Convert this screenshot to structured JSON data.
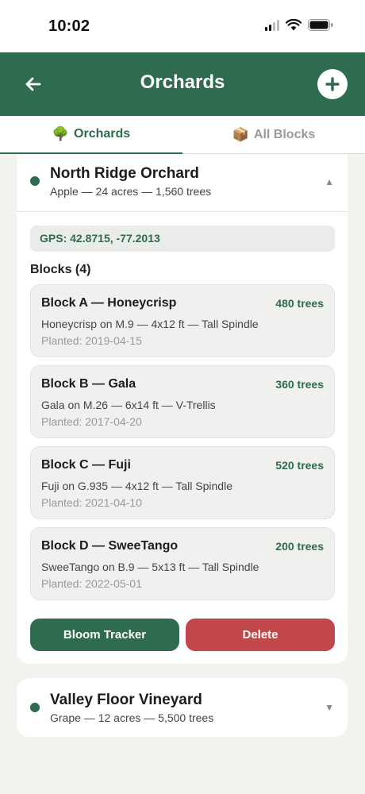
{
  "status_bar": {
    "time": "10:02"
  },
  "header": {
    "title": "Orchards"
  },
  "tabs": [
    {
      "label": "Orchards",
      "emoji": "🌳",
      "active": true
    },
    {
      "label": "All Blocks",
      "emoji": "📦",
      "active": false
    }
  ],
  "orchards": [
    {
      "name": "North Ridge Orchard",
      "meta": "Apple — 24 acres — 1,560 trees",
      "expanded": true,
      "caret": "▲",
      "gps": "GPS: 42.8715, -77.2013",
      "blocks_title": "Blocks (4)",
      "blocks": [
        {
          "name": "Block A — Honeycrisp",
          "trees": "480 trees",
          "desc": "Honeycrisp on M.9 — 4x12 ft — Tall Spindle",
          "planted": "Planted: 2019-04-15"
        },
        {
          "name": "Block B — Gala",
          "trees": "360 trees",
          "desc": "Gala on M.26 — 6x14 ft — V-Trellis",
          "planted": "Planted: 2017-04-20"
        },
        {
          "name": "Block C — Fuji",
          "trees": "520 trees",
          "desc": "Fuji on G.935 — 4x12 ft — Tall Spindle",
          "planted": "Planted: 2021-04-10"
        },
        {
          "name": "Block D — SweeTango",
          "trees": "200 trees",
          "desc": "SweeTango on B.9 — 5x13 ft — Tall Spindle",
          "planted": "Planted: 2022-05-01"
        }
      ],
      "actions": {
        "bloom_label": "Bloom Tracker",
        "delete_label": "Delete"
      }
    },
    {
      "name": "Valley Floor Vineyard",
      "meta": "Grape — 12 acres — 5,500 trees",
      "expanded": false,
      "caret": "▼"
    }
  ],
  "colors": {
    "brand": "#2f6b4f",
    "danger": "#c1474b",
    "background": "#f2f2ef"
  },
  "icons": {
    "back": "arrow-left-icon",
    "add": "plus-circle-icon"
  }
}
